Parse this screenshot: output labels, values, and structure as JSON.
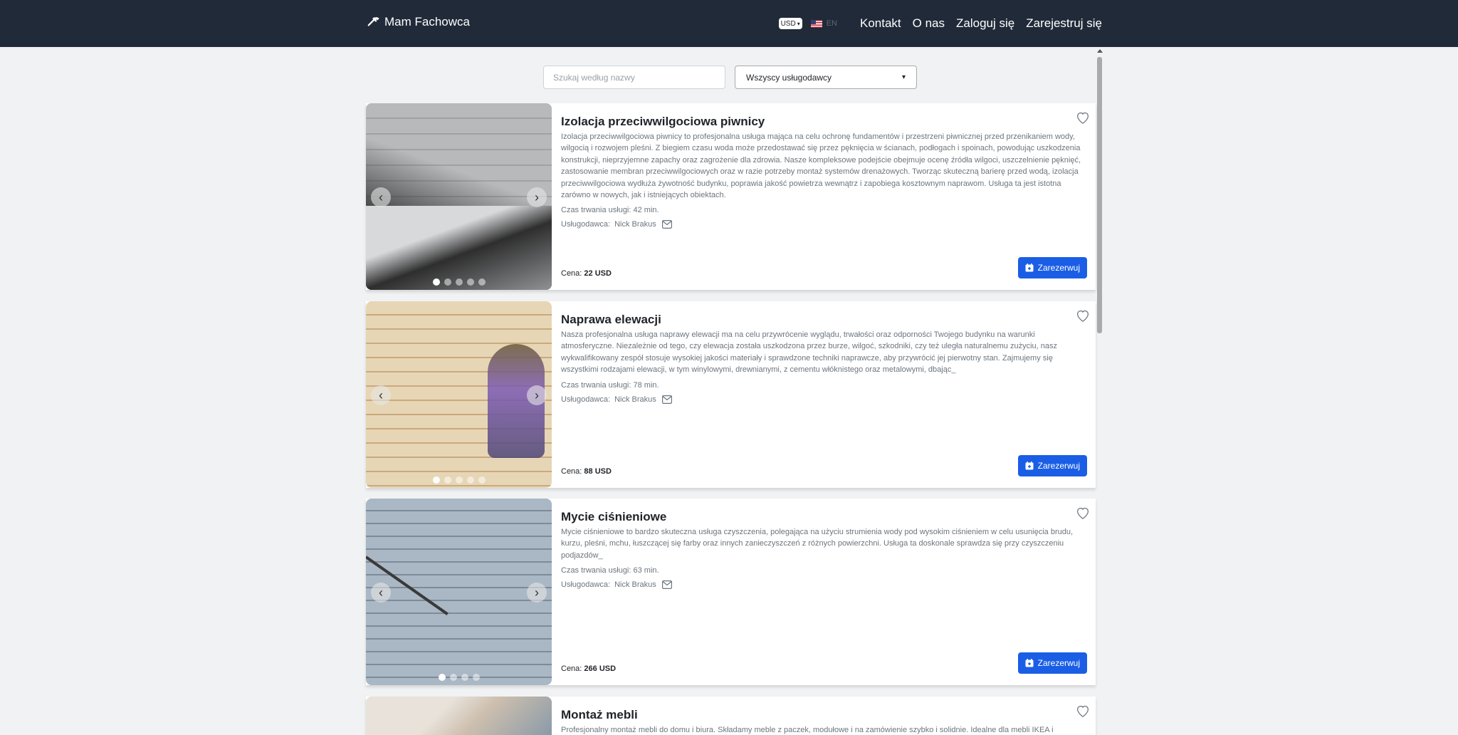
{
  "nav": {
    "brand": "Mam Fachowca",
    "currency": "USD",
    "lang": "EN",
    "links": [
      "Kontakt",
      "O nas",
      "Zaloguj się",
      "Zarejestruj się"
    ]
  },
  "filters": {
    "search_placeholder": "Szukaj według nazwy",
    "provider_select": "Wszyscy usługodawcy"
  },
  "labels": {
    "duration_prefix": "Czas trwania usługi:",
    "provider_prefix": "Usługodawca:",
    "price_prefix": "Cena:",
    "book_button": "Zarezerwuj"
  },
  "services": [
    {
      "title": "Izolacja przeciwwilgociowa piwnicy",
      "description": "Izolacja przeciwwilgociowa piwnicy to profesjonalna usługa mająca na celu ochronę fundamentów i przestrzeni piwnicznej przed przenikaniem wody, wilgocią i rozwojem pleśni. Z biegiem czasu woda może przedostawać się przez pęknięcia w ścianach, podłogach i spoinach, powodując uszkodzenia konstrukcji, nieprzyjemne zapachy oraz zagrożenie dla zdrowia. Nasze kompleksowe podejście obejmuje ocenę źródła wilgoci, uszczelnienie pęknięć, zastosowanie membran przeciwwilgociowych oraz w razie potrzeby montaż systemów drenażowych. Tworząc skuteczną barierę przed wodą, izolacja przeciwwilgociowa wydłuża żywotność budynku, poprawia jakość powietrza wewnątrz i zapobiega kosztownym naprawom. Usługa ta jest istotna zarówno w nowych, jak i istniejących obiektach.",
      "duration": "42 min.",
      "provider": "Nick Brakus",
      "price": "22 USD",
      "image_count": 5
    },
    {
      "title": "Naprawa elewacji",
      "description": "Nasza profesjonalna usługa naprawy elewacji ma na celu przywrócenie wyglądu, trwałości oraz odporności Twojego budynku na warunki atmosferyczne. Niezależnie od tego, czy elewacja została uszkodzona przez burze, wilgoć, szkodniki, czy też uległa naturalnemu zużyciu, nasz wykwalifikowany zespół stosuje wysokiej jakości materiały i sprawdzone techniki naprawcze, aby przywrócić jej pierwotny stan. Zajmujemy się wszystkimi rodzajami elewacji, w tym winylowymi, drewnianymi, z cementu włóknistego oraz metalowymi, dbając_",
      "duration": "78 min.",
      "provider": "Nick Brakus",
      "price": "88 USD",
      "image_count": 5
    },
    {
      "title": "Mycie ciśnieniowe",
      "description": "Mycie ciśnieniowe to bardzo skuteczna usługa czyszczenia, polegająca na użyciu strumienia wody pod wysokim ciśnieniem w celu usunięcia brudu, kurzu, pleśni, mchu, łuszczącej się farby oraz innych zanieczyszczeń z różnych powierzchni. Usługa ta doskonale sprawdza się przy czyszczeniu podjazdów_",
      "duration": "63 min.",
      "provider": "Nick Brakus",
      "price": "266 USD",
      "image_count": 4
    },
    {
      "title": "Montaż mebli",
      "description": "Profesjonalny montaż mebli do domu i biura. Składamy meble z paczek, modułowe i na zamówienie szybko i solidnie. Idealne dla mebli IKEA i"
    }
  ]
}
